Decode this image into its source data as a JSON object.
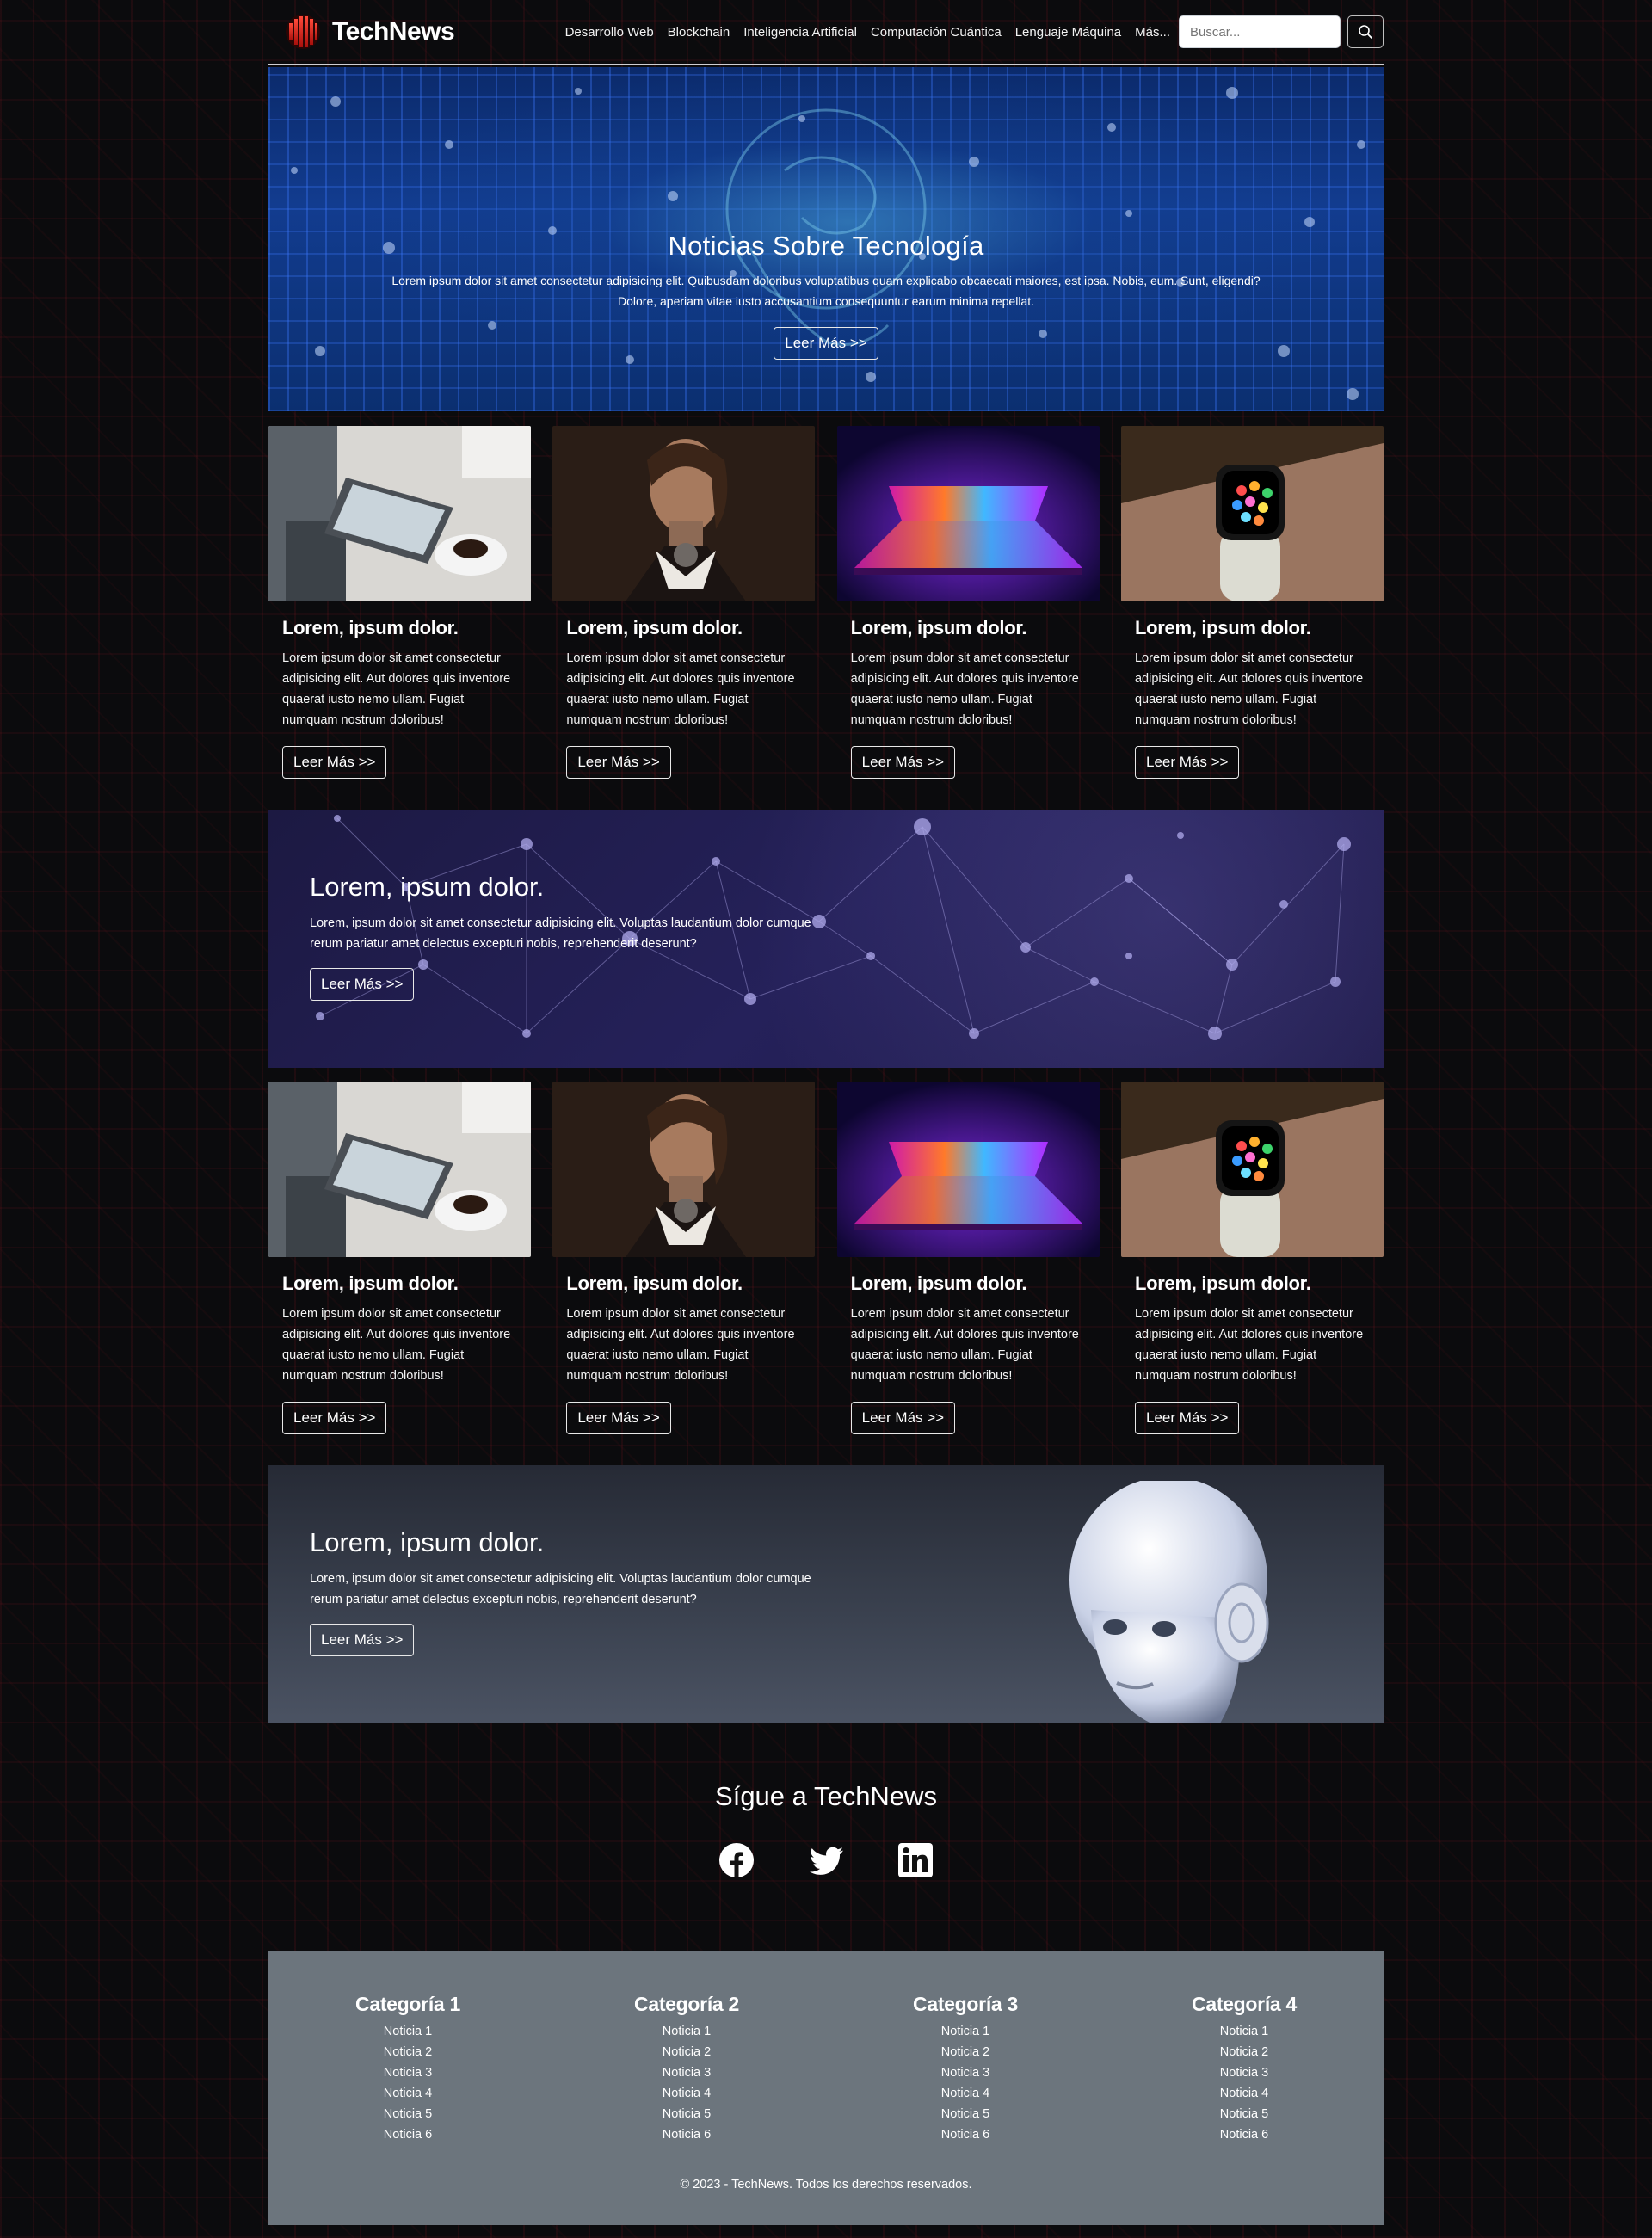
{
  "brand": {
    "name": "TechNews"
  },
  "nav": {
    "links": [
      "Desarrollo Web",
      "Blockchain",
      "Inteligencia Artificial",
      "Computación Cuántica",
      "Lenguaje Máquina",
      "Más..."
    ],
    "search_placeholder": "Buscar..."
  },
  "hero": {
    "title": "Noticias Sobre Tecnología",
    "text": "Lorem ipsum dolor sit amet consectetur adipisicing elit. Quibusdam doloribus voluptatibus quam explicabo obcaecati maiores, est ipsa. Nobis, eum. Sunt, eligendi? Dolore, aperiam vitae iusto accusantium consequuntur earum minima repellat.",
    "button": "Leer Más >>"
  },
  "cards_row_1": [
    {
      "title": "Lorem, ipsum dolor.",
      "text": "Lorem ipsum dolor sit amet consectetur adipisicing elit. Aut dolores quis inventore quaerat iusto nemo ullam. Fugiat numquam nostrum doloribus!",
      "button": "Leer Más >>",
      "image": "tablet-coffee"
    },
    {
      "title": "Lorem, ipsum dolor.",
      "text": "Lorem ipsum dolor sit amet consectetur adipisicing elit. Aut dolores quis inventore quaerat iusto nemo ullam. Fugiat numquam nostrum doloribus!",
      "button": "Leer Más >>",
      "image": "android-woman"
    },
    {
      "title": "Lorem, ipsum dolor.",
      "text": "Lorem ipsum dolor sit amet consectetur adipisicing elit. Aut dolores quis inventore quaerat iusto nemo ullam. Fugiat numquam nostrum doloribus!",
      "button": "Leer Más >>",
      "image": "neon-laptop"
    },
    {
      "title": "Lorem, ipsum dolor.",
      "text": "Lorem ipsum dolor sit amet consectetur adipisicing elit. Aut dolores quis inventore quaerat iusto nemo ullam. Fugiat numquam nostrum doloribus!",
      "button": "Leer Más >>",
      "image": "smartwatch"
    }
  ],
  "banner_1": {
    "title": "Lorem, ipsum dolor.",
    "text": "Lorem, ipsum dolor sit amet consectetur adipisicing elit. Voluptas laudantium dolor cumque rerum pariatur amet delectus excepturi nobis, reprehenderit deserunt?",
    "button": "Leer Más >>"
  },
  "cards_row_2": [
    {
      "title": "Lorem, ipsum dolor.",
      "text": "Lorem ipsum dolor sit amet consectetur adipisicing elit. Aut dolores quis inventore quaerat iusto nemo ullam. Fugiat numquam nostrum doloribus!",
      "button": "Leer Más >>",
      "image": "tablet-coffee"
    },
    {
      "title": "Lorem, ipsum dolor.",
      "text": "Lorem ipsum dolor sit amet consectetur adipisicing elit. Aut dolores quis inventore quaerat iusto nemo ullam. Fugiat numquam nostrum doloribus!",
      "button": "Leer Más >>",
      "image": "android-woman"
    },
    {
      "title": "Lorem, ipsum dolor.",
      "text": "Lorem ipsum dolor sit amet consectetur adipisicing elit. Aut dolores quis inventore quaerat iusto nemo ullam. Fugiat numquam nostrum doloribus!",
      "button": "Leer Más >>",
      "image": "neon-laptop"
    },
    {
      "title": "Lorem, ipsum dolor.",
      "text": "Lorem ipsum dolor sit amet consectetur adipisicing elit. Aut dolores quis inventore quaerat iusto nemo ullam. Fugiat numquam nostrum doloribus!",
      "button": "Leer Más >>",
      "image": "smartwatch"
    }
  ],
  "banner_2": {
    "title": "Lorem, ipsum dolor.",
    "text": "Lorem, ipsum dolor sit amet consectetur adipisicing elit. Voluptas laudantium dolor cumque rerum pariatur amet delectus excepturi nobis, reprehenderit deserunt?",
    "button": "Leer Más >>"
  },
  "social": {
    "title": "Sígue a TechNews",
    "icons": [
      "facebook-icon",
      "twitter-icon",
      "linkedin-icon"
    ]
  },
  "footer": {
    "columns": [
      {
        "title": "Categoría 1",
        "items": [
          "Noticia 1",
          "Noticia 2",
          "Noticia 3",
          "Noticia 4",
          "Noticia 5",
          "Noticia 6"
        ]
      },
      {
        "title": "Categoría 2",
        "items": [
          "Noticia 1",
          "Noticia 2",
          "Noticia 3",
          "Noticia 4",
          "Noticia 5",
          "Noticia 6"
        ]
      },
      {
        "title": "Categoría 3",
        "items": [
          "Noticia 1",
          "Noticia 2",
          "Noticia 3",
          "Noticia 4",
          "Noticia 5",
          "Noticia 6"
        ]
      },
      {
        "title": "Categoría 4",
        "items": [
          "Noticia 1",
          "Noticia 2",
          "Noticia 3",
          "Noticia 4",
          "Noticia 5",
          "Noticia 6"
        ]
      }
    ],
    "copyright": "© 2023 - TechNews. Todos los derechos reservados."
  },
  "colors": {
    "footer_bg": "#6c757d",
    "brand_red": "#e0241b",
    "page_bg": "#0b0b0d"
  }
}
